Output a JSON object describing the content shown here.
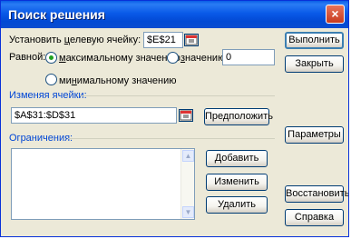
{
  "window": {
    "title": "Поиск решения",
    "close_glyph": "×"
  },
  "target": {
    "label_prefix": "Установить ",
    "label_underlined": "ц",
    "label_suffix": "елевую ячейку:",
    "value": "$E$21"
  },
  "equal": {
    "label": "Равной:",
    "max_label_pre": "",
    "max_label_ul": "м",
    "max_label_post": "аксимальному значению",
    "value_label_pre": "",
    "value_label_ul": "з",
    "value_label_post": "начению:",
    "value_input": "0",
    "min_label_pre": "ми",
    "min_label_ul": "н",
    "min_label_post": "имальному значению",
    "selected": "max"
  },
  "changing": {
    "group_label": "Изменяя ячейки:",
    "value": "$A$31:$D$31",
    "guess_button": "Предположить"
  },
  "constraints": {
    "group_label": "Ограничения:",
    "items": []
  },
  "buttons": {
    "solve": "Выполнить",
    "close": "Закрыть",
    "options": "Параметры",
    "add": "Добавить",
    "change": "Изменить",
    "delete": "Удалить",
    "reset": "Восстановить",
    "help": "Справка"
  },
  "colors": {
    "titlebar": "#0a5ae8",
    "face": "#ece9d8",
    "group_label": "#0046d5",
    "radio_dot": "#21a121"
  }
}
